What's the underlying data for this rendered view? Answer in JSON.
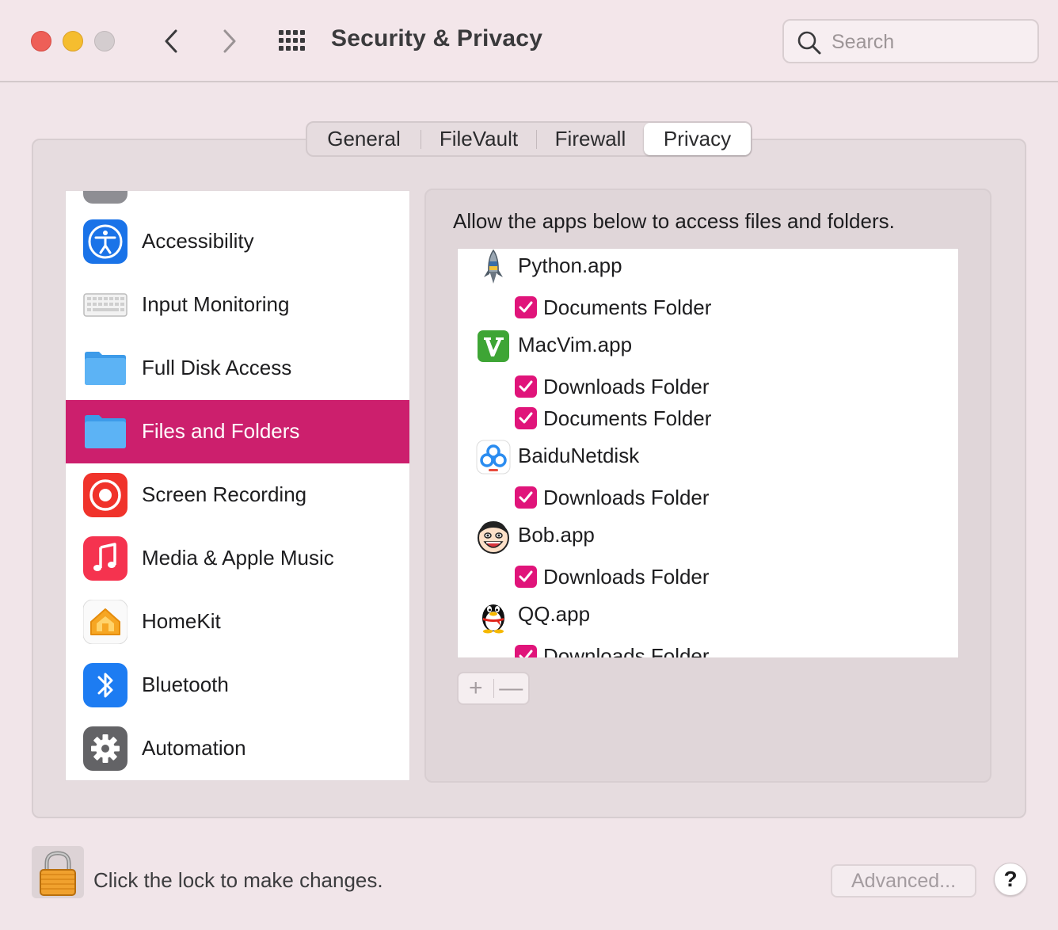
{
  "window": {
    "title": "Security & Privacy",
    "search_placeholder": "Search"
  },
  "tabs": [
    {
      "label": "General",
      "selected": false
    },
    {
      "label": "FileVault",
      "selected": false
    },
    {
      "label": "Firewall",
      "selected": false
    },
    {
      "label": "Privacy",
      "selected": true
    }
  ],
  "categories": [
    {
      "label": "Accessibility",
      "icon": "accessibility-icon"
    },
    {
      "label": "Input Monitoring",
      "icon": "keyboard-icon"
    },
    {
      "label": "Full Disk Access",
      "icon": "folder-icon"
    },
    {
      "label": "Files and Folders",
      "icon": "folder-icon",
      "selected": true
    },
    {
      "label": "Screen Recording",
      "icon": "screen-recording-icon"
    },
    {
      "label": "Media & Apple Music",
      "icon": "music-icon"
    },
    {
      "label": "HomeKit",
      "icon": "homekit-icon"
    },
    {
      "label": "Bluetooth",
      "icon": "bluetooth-icon"
    },
    {
      "label": "Automation",
      "icon": "gear-icon"
    }
  ],
  "detail": {
    "description": "Allow the apps below to access files and folders.",
    "apps": [
      {
        "name": "Python.app",
        "icon": "python-rocket-icon",
        "permissions": [
          {
            "label": "Documents Folder",
            "checked": true
          }
        ]
      },
      {
        "name": "MacVim.app",
        "icon": "macvim-icon",
        "permissions": [
          {
            "label": "Downloads Folder",
            "checked": true
          },
          {
            "label": "Documents Folder",
            "checked": true
          }
        ]
      },
      {
        "name": "BaiduNetdisk",
        "icon": "baidunetdisk-icon",
        "permissions": [
          {
            "label": "Downloads Folder",
            "checked": true
          }
        ]
      },
      {
        "name": "Bob.app",
        "icon": "bob-face-icon",
        "permissions": [
          {
            "label": "Downloads Folder",
            "checked": true
          }
        ]
      },
      {
        "name": "QQ.app",
        "icon": "qq-penguin-icon",
        "permissions": [
          {
            "label": "Downloads Folder",
            "checked": true
          }
        ]
      }
    ],
    "add_label": "+",
    "remove_label": "—"
  },
  "footer": {
    "lock_text": "Click the lock to make changes.",
    "advanced_label": "Advanced...",
    "help_label": "?"
  },
  "colors": {
    "accent": "#cc1f6d",
    "checkbox": "#e0147a",
    "background": "#f1e5e9"
  }
}
